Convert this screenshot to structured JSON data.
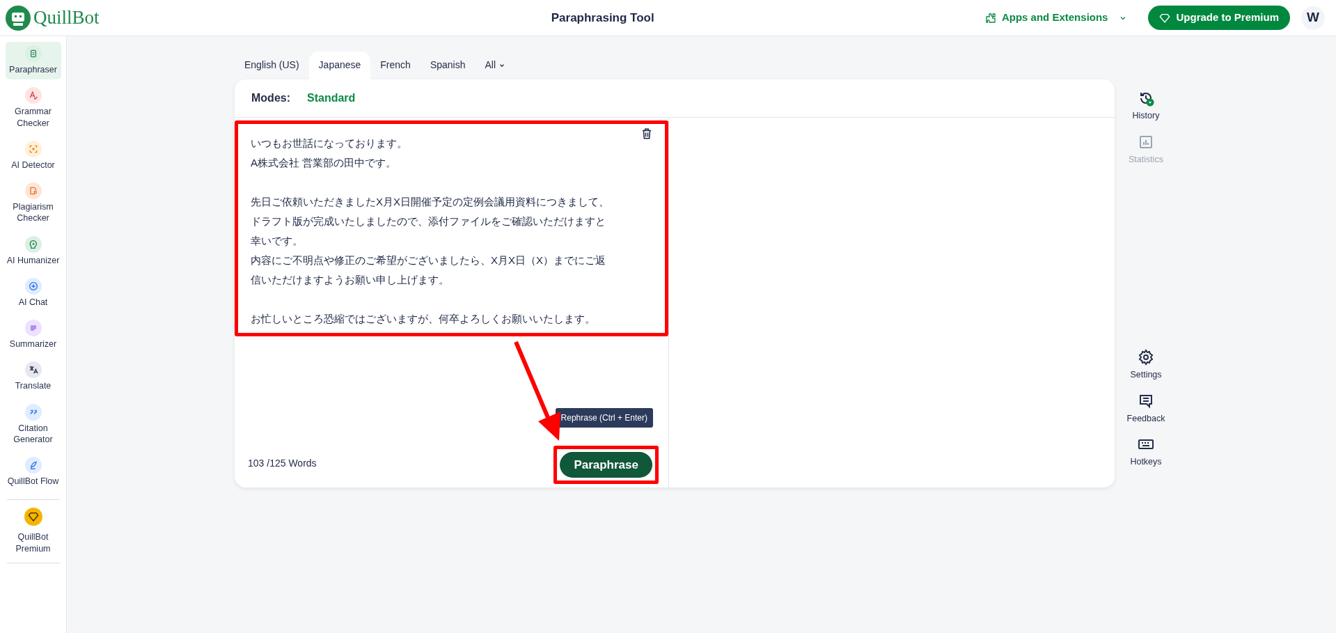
{
  "header": {
    "logo_text": "QuillBot",
    "title": "Paraphrasing Tool",
    "apps_menu": "Apps and Extensions",
    "upgrade_button": "Upgrade to Premium",
    "avatar": "W"
  },
  "sidebar": {
    "items": [
      {
        "label": "Paraphraser",
        "selected": true
      },
      {
        "label": "Grammar Checker",
        "selected": false
      },
      {
        "label": "AI Detector",
        "selected": false
      },
      {
        "label": "Plagiarism Checker",
        "selected": false
      },
      {
        "label": "AI Humanizer",
        "selected": false
      },
      {
        "label": "AI Chat",
        "selected": false
      },
      {
        "label": "Summarizer",
        "selected": false
      },
      {
        "label": "Translate",
        "selected": false
      },
      {
        "label": "Citation Generator",
        "selected": false
      },
      {
        "label": "QuillBot Flow",
        "selected": false
      }
    ],
    "premium": {
      "label": "QuillBot Premium"
    }
  },
  "language_tabs": [
    {
      "label": "English (US)",
      "selected": false
    },
    {
      "label": "Japanese",
      "selected": true
    },
    {
      "label": "French",
      "selected": false
    },
    {
      "label": "Spanish",
      "selected": false
    },
    {
      "label": "All",
      "selected": false,
      "dropdown": true
    }
  ],
  "modes": {
    "label": "Modes:",
    "current": "Standard"
  },
  "input": {
    "paragraphs": [
      [
        "いつもお世話になっております。",
        "A株式会社 営業部の田中です。"
      ],
      [
        "先日ご依頼いただきましたX月X日開催予定の定例会議用資料につきまして、",
        "ドラフト版が完成いたしましたので、添付ファイルをご確認いただけますと",
        "幸いです。",
        "内容にご不明点や修正のご希望がございましたら、X月X日（X）までにご返",
        "信いただけますようお願い申し上げます。"
      ],
      [
        "お忙しいところ恐縮ではございますが、何卒よろしくお願いいたします。"
      ]
    ],
    "word_count": "103 /125 Words",
    "highlighted": true
  },
  "tooltip": "Rephrase (Ctrl + Enter)",
  "paraphrase_button": {
    "label": "Paraphrase",
    "highlighted": true
  },
  "annotation_arrow": true,
  "right_rail": {
    "top": [
      {
        "label": "History",
        "disabled": false
      },
      {
        "label": "Statistics",
        "disabled": true
      }
    ],
    "bottom": [
      {
        "label": "Settings",
        "disabled": false
      },
      {
        "label": "Feedback",
        "disabled": false
      },
      {
        "label": "Hotkeys",
        "disabled": false
      }
    ]
  }
}
